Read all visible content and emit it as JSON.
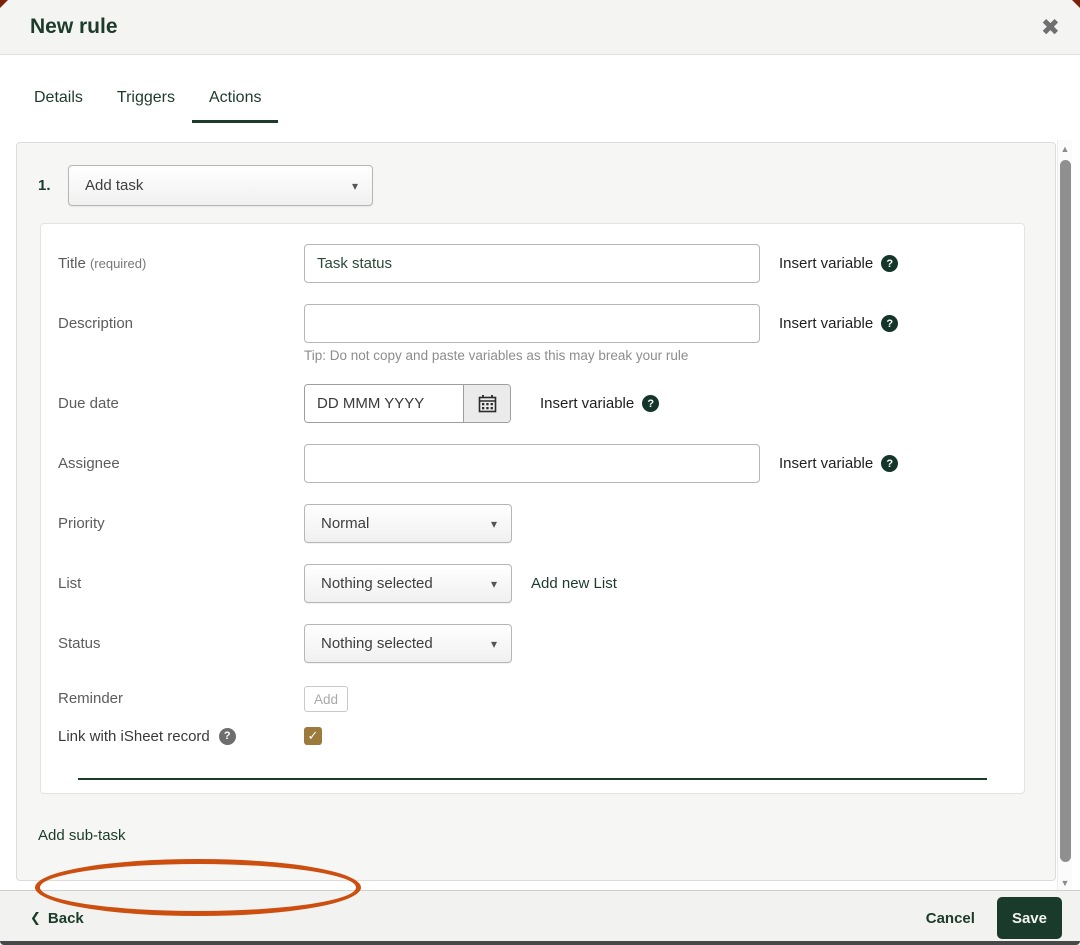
{
  "modal": {
    "title": "New rule"
  },
  "icons": {
    "close": "✖",
    "chevron_down": "▾",
    "help": "?",
    "back_chevron": "❮",
    "scroll_up": "▲",
    "scroll_down": "▼",
    "check": "✓"
  },
  "tabs": [
    {
      "label": "Details",
      "active": false
    },
    {
      "label": "Triggers",
      "active": false
    },
    {
      "label": "Actions",
      "active": true
    }
  ],
  "action": {
    "index": "1.",
    "type": "Add task"
  },
  "form": {
    "insert_variable": "Insert variable",
    "title": {
      "label": "Title",
      "required": "(required)",
      "value": "Task status"
    },
    "description": {
      "label": "Description",
      "value": "",
      "tip": "Tip: Do not copy and paste variables as this may break your rule"
    },
    "due_date": {
      "label": "Due date",
      "placeholder": "DD MMM YYYY"
    },
    "assignee": {
      "label": "Assignee",
      "value": ""
    },
    "priority": {
      "label": "Priority",
      "value": "Normal"
    },
    "list": {
      "label": "List",
      "value": "Nothing selected",
      "add_new": "Add new List"
    },
    "status": {
      "label": "Status",
      "value": "Nothing selected"
    },
    "reminder": {
      "label": "Reminder",
      "add": "Add"
    },
    "isheet": {
      "label": "Link with iSheet record",
      "checked": true
    }
  },
  "add_subtask": "Add sub-task",
  "footer": {
    "back": "Back",
    "cancel": "Cancel",
    "save": "Save"
  },
  "colors": {
    "accent_green": "#1c3b2b",
    "checkbox_brown": "#9c7a3c",
    "annotation_orange": "#cc4f10"
  }
}
